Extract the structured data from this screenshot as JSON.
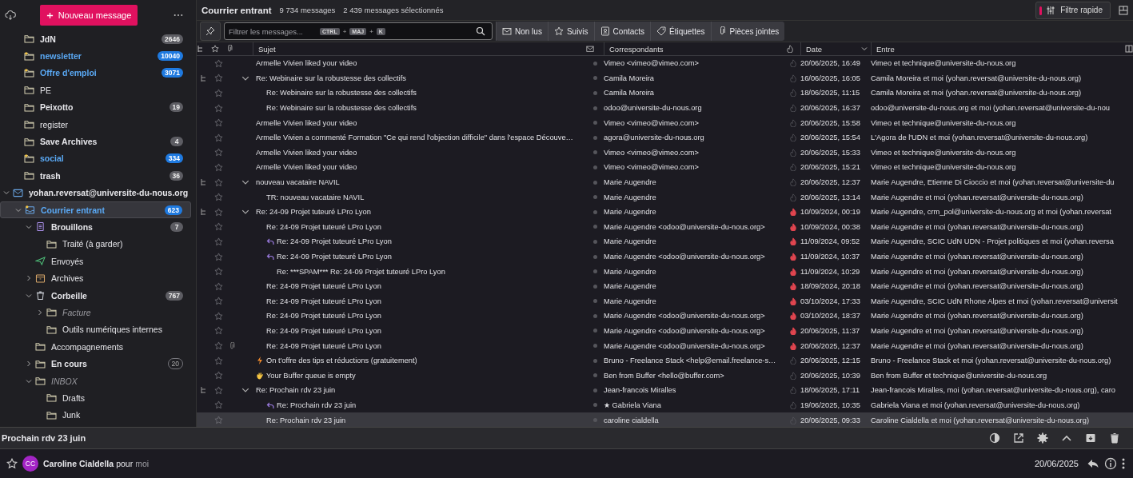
{
  "folder_pane": {
    "new_message_button": "Nouveau message",
    "folders": [
      {
        "name": "JdN",
        "kind": "folder",
        "unread": true,
        "disabled": false,
        "new": false,
        "selected": false,
        "count": "2646"
      },
      {
        "name": "newsletter",
        "kind": "folder",
        "unread": true,
        "disabled": false,
        "new": true,
        "selected": false,
        "count": "10040"
      },
      {
        "name": "Offre d'emploi",
        "kind": "folder",
        "unread": true,
        "disabled": false,
        "new": true,
        "selected": false,
        "count": "3071"
      },
      {
        "name": "PE",
        "kind": "folder",
        "unread": false,
        "disabled": false,
        "new": false,
        "selected": false
      },
      {
        "name": "Peixotto",
        "kind": "folder",
        "unread": true,
        "disabled": false,
        "new": false,
        "selected": false,
        "count": "19"
      },
      {
        "name": "register",
        "kind": "folder",
        "unread": false,
        "disabled": false,
        "new": false,
        "selected": false
      },
      {
        "name": "Save Archives",
        "kind": "folder",
        "unread": true,
        "disabled": false,
        "new": false,
        "selected": false,
        "count": "4"
      },
      {
        "name": "social",
        "kind": "folder",
        "unread": true,
        "disabled": false,
        "new": true,
        "selected": false,
        "count": "334"
      },
      {
        "name": "trash",
        "kind": "folder",
        "unread": true,
        "disabled": false,
        "new": false,
        "selected": false,
        "count": "36"
      }
    ],
    "account": {
      "name": "yohan.reversat@universite-du-nous.org",
      "kind": "account",
      "unread": true,
      "disabled": false,
      "new": false,
      "selected": false,
      "expanded": true,
      "children": [
        {
          "name": "Courrier entrant",
          "kind": "inbox",
          "unread": true,
          "disabled": false,
          "new": true,
          "selected": true,
          "count": "623",
          "expanded": true,
          "children": [
            {
              "name": "Brouillons",
              "kind": "drafts",
              "unread": true,
              "disabled": false,
              "new": false,
              "selected": false,
              "count": "7",
              "expanded": true,
              "children": [
                {
                  "name": "Traité (à garder)",
                  "kind": "folder",
                  "unread": false,
                  "disabled": false,
                  "new": false,
                  "selected": false
                }
              ]
            },
            {
              "name": "Envoyés",
              "kind": "sent",
              "unread": false,
              "disabled": false,
              "new": false,
              "selected": false
            },
            {
              "name": "Archives",
              "kind": "archive",
              "unread": false,
              "disabled": false,
              "new": false,
              "selected": false,
              "expanded": false
            },
            {
              "name": "Corbeille",
              "kind": "trash",
              "unread": true,
              "disabled": false,
              "new": false,
              "selected": false,
              "count": "767",
              "expanded": true,
              "children": [
                {
                  "name": "Facture",
                  "kind": "folder",
                  "unread": false,
                  "disabled": true,
                  "new": false,
                  "selected": false,
                  "expanded": false
                },
                {
                  "name": "Outils numériques internes",
                  "kind": "folder",
                  "unread": false,
                  "disabled": false,
                  "new": false,
                  "selected": false
                }
              ]
            },
            {
              "name": "Accompagnements",
              "kind": "folder",
              "unread": false,
              "disabled": false,
              "new": false,
              "selected": false
            },
            {
              "name": "En cours",
              "kind": "folder",
              "unread": true,
              "disabled": false,
              "new": false,
              "selected": false,
              "count": "20",
              "expanded": false
            },
            {
              "name": "INBOX",
              "kind": "folder",
              "unread": false,
              "disabled": true,
              "new": false,
              "selected": false,
              "expanded": true,
              "children": [
                {
                  "name": "Drafts",
                  "kind": "folder",
                  "unread": false,
                  "disabled": false,
                  "new": false,
                  "selected": false
                },
                {
                  "name": "Junk",
                  "kind": "folder",
                  "unread": false,
                  "disabled": false,
                  "new": false,
                  "selected": false
                }
              ]
            }
          ]
        }
      ]
    }
  },
  "toolbar": {
    "folder_title": "Courrier entrant",
    "message_count": "9 734 messages",
    "selected_count": "2 439 messages sélectionnés",
    "quick_filter": {
      "label": "Filtre rapide",
      "on": true
    }
  },
  "filter_bar": {
    "placeholder": "Filtrer les messages...",
    "shortcut": [
      "CTRL",
      "+",
      "MAJ",
      "+",
      "K"
    ],
    "buttons": [
      {
        "label": "Non lus",
        "kind": "unread",
        "selected": false
      },
      {
        "label": "Suivis",
        "kind": "star",
        "selected": false
      },
      {
        "label": "Contacts",
        "kind": "contacts",
        "selected": false
      },
      {
        "label": "Étiquettes",
        "kind": "tag",
        "selected": false
      },
      {
        "label": "Pièces jointes",
        "kind": "attachment",
        "selected": false
      }
    ]
  },
  "columns": {
    "subject": "Sujet",
    "correspondents": "Correspondants",
    "date": "Date",
    "recipients": "Entre"
  },
  "messages": [
    {
      "subject": "Armelle Vivien liked your video",
      "correspondent": "Vimeo <vimeo@vimeo.com>",
      "date": "20/06/2025, 16:49",
      "recipients": "Vimeo et technique@universite-du-nous.org",
      "starred": false,
      "attachment": false,
      "replied": false,
      "junk": false,
      "selected": false
    },
    {
      "subject": "Re: Webinaire sur la robustesse des collectifs",
      "correspondent": "Camila Moreira",
      "date": "16/06/2025, 16:05",
      "recipients": "Camila Moreira et moi (yohan.reversat@universite-du-nous.org)",
      "starred": false,
      "attachment": false,
      "replied": false,
      "junk": false,
      "selected": false,
      "expanded": true,
      "children": [
        {
          "subject": "Re: Webinaire sur la robustesse des collectifs",
          "correspondent": "Camila Moreira",
          "date": "18/06/2025, 11:15",
          "recipients": "Camila Moreira et moi (yohan.reversat@universite-du-nous.org)",
          "starred": false,
          "attachment": false,
          "replied": false,
          "junk": false,
          "selected": false
        },
        {
          "subject": "Re: Webinaire sur la robustesse des collectifs",
          "correspondent": "odoo@universite-du-nous.org",
          "date": "20/06/2025, 16:37",
          "recipients": "odoo@universite-du-nous.org et moi (yohan.reversat@universite-du-nou",
          "starred": false,
          "attachment": false,
          "replied": false,
          "junk": false,
          "selected": false
        }
      ]
    },
    {
      "subject": "Armelle Vivien liked your video",
      "correspondent": "Vimeo <vimeo@vimeo.com>",
      "date": "20/06/2025, 15:58",
      "recipients": "Vimeo et technique@universite-du-nous.org",
      "starred": false,
      "attachment": false,
      "replied": false,
      "junk": false,
      "selected": false
    },
    {
      "subject": "Armelle Vivien a commenté Formation \"Ce qui rend l'objection difficile\" dans l'espace Découve…",
      "correspondent": "agora@universite-du-nous.org",
      "date": "20/06/2025, 15:54",
      "recipients": "L'Agora de l'UDN et moi (yohan.reversat@universite-du-nous.org)",
      "starred": false,
      "attachment": false,
      "replied": false,
      "junk": false,
      "selected": false
    },
    {
      "subject": "Armelle Vivien liked your video",
      "correspondent": "Vimeo <vimeo@vimeo.com>",
      "date": "20/06/2025, 15:33",
      "recipients": "Vimeo et technique@universite-du-nous.org",
      "starred": false,
      "attachment": false,
      "replied": false,
      "junk": false,
      "selected": false
    },
    {
      "subject": "Armelle Vivien liked your video",
      "correspondent": "Vimeo <vimeo@vimeo.com>",
      "date": "20/06/2025, 15:21",
      "recipients": "Vimeo et technique@universite-du-nous.org",
      "starred": false,
      "attachment": false,
      "replied": false,
      "junk": false,
      "selected": false
    },
    {
      "subject": "nouveau vacataire NAVIL",
      "correspondent": "Marie Augendre",
      "date": "20/06/2025, 12:37",
      "recipients": "Marie Augendre, Etienne Di Cioccio et moi (yohan.reversat@universite-du",
      "starred": false,
      "attachment": false,
      "replied": false,
      "junk": false,
      "selected": false,
      "expanded": true,
      "children": [
        {
          "subject": "TR: nouveau vacataire NAVIL",
          "correspondent": "Marie Augendre",
          "date": "20/06/2025, 13:14",
          "recipients": "Marie Augendre et moi (yohan.reversat@universite-du-nous.org)",
          "starred": false,
          "attachment": false,
          "replied": false,
          "junk": false,
          "selected": false
        }
      ]
    },
    {
      "subject": "Re: 24-09 Projet tuteuré LPro Lyon",
      "correspondent": "Marie Augendre",
      "date": "10/09/2024, 00:19",
      "recipients": "Marie Augendre, crm_pol@universite-du-nous.org et moi (yohan.reversat",
      "starred": false,
      "attachment": false,
      "replied": false,
      "junk": true,
      "selected": false,
      "expanded": true,
      "children": [
        {
          "subject": "Re: 24-09 Projet tuteuré LPro Lyon",
          "correspondent": "Marie Augendre <odoo@universite-du-nous.org>",
          "date": "10/09/2024, 00:38",
          "recipients": "Marie Augendre et moi (yohan.reversat@universite-du-nous.org)",
          "starred": false,
          "attachment": false,
          "replied": false,
          "junk": true,
          "selected": false
        },
        {
          "subject": "Re: 24-09 Projet tuteuré LPro Lyon",
          "correspondent": "Marie Augendre",
          "date": "11/09/2024, 09:52",
          "recipients": "Marie Augendre, SCIC UdN UDN - Projet politiques et moi (yohan.reversa",
          "starred": false,
          "attachment": false,
          "replied": true,
          "junk": true,
          "selected": false
        },
        {
          "subject": "Re: 24-09 Projet tuteuré LPro Lyon",
          "correspondent": "Marie Augendre <odoo@universite-du-nous.org>",
          "date": "11/09/2024, 10:37",
          "recipients": "Marie Augendre et moi (yohan.reversat@universite-du-nous.org)",
          "starred": false,
          "attachment": false,
          "replied": true,
          "junk": true,
          "selected": false,
          "children": [
            {
              "subject": "Re: ***SPAM*** Re: 24-09 Projet tuteuré LPro Lyon",
              "correspondent": "Marie Augendre",
              "date": "11/09/2024, 10:29",
              "recipients": "Marie Augendre et moi (yohan.reversat@universite-du-nous.org)",
              "starred": false,
              "attachment": false,
              "replied": false,
              "junk": true,
              "selected": false
            }
          ]
        },
        {
          "subject": "Re: 24-09 Projet tuteuré LPro Lyon",
          "correspondent": "Marie Augendre",
          "date": "18/09/2024, 20:18",
          "recipients": "Marie Augendre et moi (yohan.reversat@universite-du-nous.org)",
          "starred": false,
          "attachment": false,
          "replied": false,
          "junk": true,
          "selected": false
        },
        {
          "subject": "Re: 24-09 Projet tuteuré LPro Lyon",
          "correspondent": "Marie Augendre",
          "date": "03/10/2024, 17:33",
          "recipients": "Marie Augendre, SCIC UdN Rhone Alpes et moi (yohan.reversat@universit",
          "starred": false,
          "attachment": false,
          "replied": false,
          "junk": true,
          "selected": false
        },
        {
          "subject": "Re: 24-09 Projet tuteuré LPro Lyon",
          "correspondent": "Marie Augendre <odoo@universite-du-nous.org>",
          "date": "03/10/2024, 18:37",
          "recipients": "Marie Augendre et moi (yohan.reversat@universite-du-nous.org)",
          "starred": false,
          "attachment": false,
          "replied": false,
          "junk": true,
          "selected": false
        },
        {
          "subject": "Re: 24-09 Projet tuteuré LPro Lyon",
          "correspondent": "Marie Augendre <odoo@universite-du-nous.org>",
          "date": "20/06/2025, 11:37",
          "recipients": "Marie Augendre et moi (yohan.reversat@universite-du-nous.org)",
          "starred": false,
          "attachment": false,
          "replied": false,
          "junk": true,
          "selected": false
        },
        {
          "subject": "Re: 24-09 Projet tuteuré LPro Lyon",
          "correspondent": "Marie Augendre <odoo@universite-du-nous.org>",
          "date": "20/06/2025, 12:37",
          "recipients": "Marie Augendre et moi (yohan.reversat@universite-du-nous.org)",
          "starred": false,
          "attachment": true,
          "replied": false,
          "junk": true,
          "selected": false
        }
      ]
    },
    {
      "subject": "On t'offre des tips et réductions (gratuitement)",
      "kind": "lightning",
      "correspondent": "Bruno - Freelance Stack <help@email.freelance-s…",
      "date": "20/06/2025, 12:15",
      "recipients": "Bruno - Freelance Stack et moi (yohan.reversat@universite-du-nous.org)",
      "starred": false,
      "attachment": false,
      "replied": false,
      "junk": false,
      "selected": false
    },
    {
      "subject": "Your Buffer queue is empty",
      "kind": "clap",
      "correspondent": "Ben from Buffer <hello@buffer.com>",
      "date": "20/06/2025, 10:39",
      "recipients": "Ben from Buffer et technique@universite-du-nous.org",
      "starred": false,
      "attachment": false,
      "replied": false,
      "junk": false,
      "selected": false
    },
    {
      "subject": "Re: Prochain rdv 23 juin",
      "correspondent": "Jean-francois Miralles",
      "date": "18/06/2025, 17:11",
      "recipients": "Jean-francois Miralles, moi (yohan.reversat@universite-du-nous.org), caro",
      "starred": false,
      "attachment": false,
      "replied": false,
      "junk": false,
      "selected": false,
      "expanded": true,
      "children": [
        {
          "subject": "Re: Prochain rdv 23 juin",
          "correspondent": "★ Gabriela Viana",
          "date": "19/06/2025, 10:35",
          "recipients": "Gabriela Viana et moi (yohan.reversat@universite-du-nous.org)",
          "starred": false,
          "attachment": false,
          "replied": true,
          "junk": false,
          "selected": false
        },
        {
          "subject": "Re: Prochain rdv 23 juin",
          "correspondent": "caroline cialdella",
          "date": "20/06/2025, 09:33",
          "recipients": "Caroline Cialdella et moi (yohan.reversat@universite-du-nous.org)",
          "starred": false,
          "attachment": false,
          "replied": false,
          "junk": false,
          "selected": true
        }
      ]
    }
  ],
  "message_subject": "Prochain rdv 23 juin",
  "message_header": {
    "starred": false,
    "avatar_initials": "CC",
    "from": "Caroline Cialdella",
    "to_label": "pour",
    "to": "moi",
    "date": "20/06/2025"
  }
}
